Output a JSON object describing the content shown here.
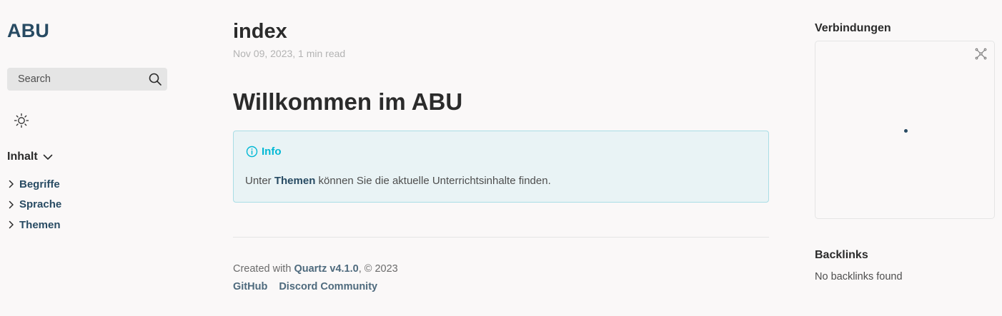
{
  "sidebar": {
    "site_title": "ABU",
    "search_placeholder": "Search",
    "explorer_title": "Inhalt",
    "tree": [
      {
        "label": "Begriffe"
      },
      {
        "label": "Sprache"
      },
      {
        "label": "Themen"
      }
    ]
  },
  "main": {
    "title": "index",
    "meta": "Nov 09, 2023, 1 min read",
    "heading": "Willkommen im ABU",
    "callout": {
      "title": "Info",
      "body_prefix": "Unter",
      "body_link": "Themen",
      "body_suffix": "können Sie die aktuelle Unterrichtsinhalte finden."
    },
    "footer": {
      "created_prefix": "Created with",
      "quartz": "Quartz v4.1.0",
      "copyright": ", © 2023",
      "links": [
        "GitHub",
        "Discord Community"
      ]
    }
  },
  "right": {
    "graph_title": "Verbindungen",
    "backlinks_title": "Backlinks",
    "backlinks_empty": "No backlinks found"
  },
  "colors": {
    "accent": "#284b63",
    "info": "#00b8d4",
    "background": "#faf8f8"
  },
  "icons": [
    "search-icon",
    "sun-icon",
    "chevron-down-icon",
    "chevron-right-icon",
    "info-icon",
    "expand-graph-icon"
  ]
}
